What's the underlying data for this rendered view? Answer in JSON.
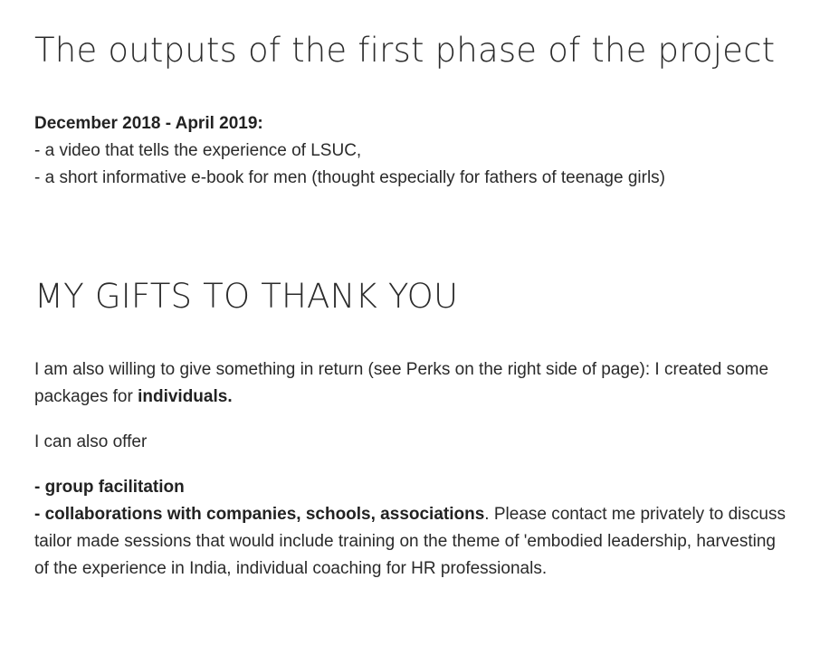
{
  "section_outputs": {
    "title": "The outputs of the first phase of the project",
    "period": "December 2018 - April 2019:",
    "items": [
      "- a video that tells the experience of LSUC,",
      "- a short informative e-book for men (thought especially for fathers of teenage girls)"
    ]
  },
  "section_gifts": {
    "title": "MY GIFTS TO THANK YOU",
    "intro_text": "I am also willing to give something in return (see Perks on the right side of page): I created some packages for ",
    "intro_bold": "individuals.",
    "offer_text": "I can also offer",
    "offer_item_1": "- group facilitation",
    "offer_item_2": "- collaborations with companies, schools, associations",
    "offer_rest": ".  Please contact me privately to discuss tailor made sessions that would include training on the theme of 'embodied leadership, harvesting of the experience in India, individual coaching for HR professionals."
  }
}
